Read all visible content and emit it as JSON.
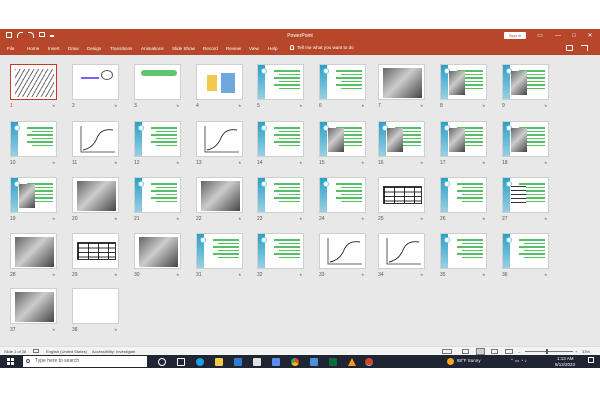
{
  "window": {
    "title": "PowerPoint",
    "signin_label": "Sign in",
    "controls": [
      "—",
      "□",
      "✕"
    ]
  },
  "colors": {
    "accent": "#b7472a",
    "selection": "#c0392b",
    "green_text": "#39b54a",
    "taskbar": "#1f2533"
  },
  "qat_icons": [
    "save-icon",
    "undo-icon",
    "redo-icon",
    "present-icon",
    "customize-icon"
  ],
  "ribbon": {
    "tabs": [
      "File",
      "Home",
      "Insert",
      "Draw",
      "Design",
      "Transitions",
      "Animations",
      "Slide Show",
      "Record",
      "Review",
      "View",
      "Help"
    ],
    "tellme": "Tell me what you want to do",
    "right_icons": [
      "comments-icon",
      "share-icon"
    ]
  },
  "slides": [
    {
      "n": "1",
      "kind": "calligraphy",
      "selected": true
    },
    {
      "n": "2",
      "kind": "image-sketch"
    },
    {
      "n": "3",
      "kind": "green-title"
    },
    {
      "n": "4",
      "kind": "diagram"
    },
    {
      "n": "5",
      "kind": "text"
    },
    {
      "n": "6",
      "kind": "text"
    },
    {
      "n": "7",
      "kind": "photo"
    },
    {
      "n": "8",
      "kind": "text-photo"
    },
    {
      "n": "9",
      "kind": "text-photo"
    },
    {
      "n": "10",
      "kind": "text"
    },
    {
      "n": "11",
      "kind": "graph"
    },
    {
      "n": "12",
      "kind": "text"
    },
    {
      "n": "13",
      "kind": "graph"
    },
    {
      "n": "14",
      "kind": "text"
    },
    {
      "n": "15",
      "kind": "text-photo"
    },
    {
      "n": "16",
      "kind": "text-photo"
    },
    {
      "n": "17",
      "kind": "text-photo"
    },
    {
      "n": "18",
      "kind": "text-photo"
    },
    {
      "n": "19",
      "kind": "text-photo"
    },
    {
      "n": "20",
      "kind": "photo"
    },
    {
      "n": "21",
      "kind": "text"
    },
    {
      "n": "22",
      "kind": "photo"
    },
    {
      "n": "23",
      "kind": "text"
    },
    {
      "n": "24",
      "kind": "text"
    },
    {
      "n": "25",
      "kind": "table"
    },
    {
      "n": "26",
      "kind": "text"
    },
    {
      "n": "27",
      "kind": "text-table"
    },
    {
      "n": "28",
      "kind": "photo"
    },
    {
      "n": "29",
      "kind": "table"
    },
    {
      "n": "30",
      "kind": "photo"
    },
    {
      "n": "31",
      "kind": "text"
    },
    {
      "n": "32",
      "kind": "text"
    },
    {
      "n": "33",
      "kind": "graph"
    },
    {
      "n": "34",
      "kind": "graph"
    },
    {
      "n": "35",
      "kind": "text"
    },
    {
      "n": "36",
      "kind": "text"
    },
    {
      "n": "37",
      "kind": "photo"
    },
    {
      "n": "38",
      "kind": "blank"
    }
  ],
  "status": {
    "slide_info": "Slide 1 of 38",
    "language": "English (United States)",
    "accessibility": "Accessibility: Investigate",
    "zoom": "33%"
  },
  "taskbar": {
    "search_placeholder": "Type here to search",
    "weather": "88°F  Sunny",
    "time": "1:13 AM",
    "date": "8/12/2023",
    "app_icons": [
      "task-view-icon",
      "edge-icon",
      "explorer-icon",
      "store-icon",
      "mail-icon",
      "photos-icon",
      "chrome-icon",
      "maps-icon",
      "vlc-icon",
      "powerpoint-icon"
    ]
  }
}
